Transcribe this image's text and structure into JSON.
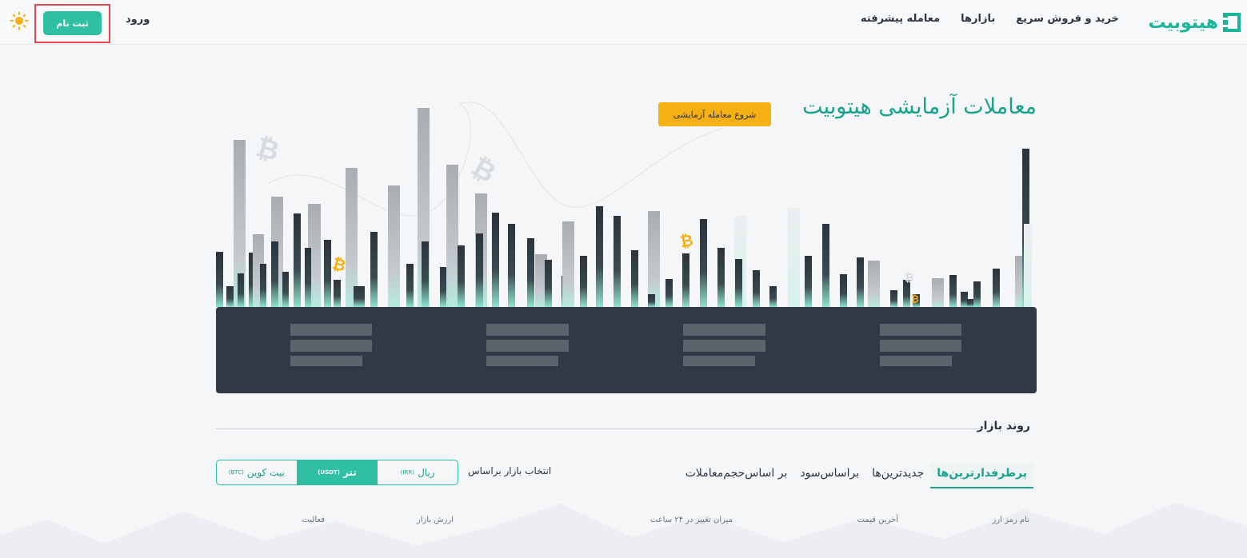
{
  "header": {
    "brand": "هیتوبیت",
    "nav": [
      "خرید و فروش سریع",
      "بازارها",
      "معامله پیشرفته"
    ],
    "login": "ورود",
    "signup": "ثبت نام",
    "theme_icon": "sun-icon"
  },
  "hero": {
    "title": "معاملات آزمایشی هیتوبیت",
    "demo_button": "شروع معامله آزمایشی"
  },
  "trend": {
    "title": "روند بازار",
    "tabs": [
      "پرطرفدارترین‌ها",
      "جدیدترین‌ها",
      "براساس‌سود",
      "بر اساس‌حجم‌معاملات"
    ],
    "active_tab": 0,
    "market_label": "انتخاب بازار براساس",
    "markets": [
      {
        "name": "ریال",
        "code": "(IRR)"
      },
      {
        "name": "تتر",
        "code": "(USDT)"
      },
      {
        "name": "بیت کوین",
        "code": "(BTC)"
      }
    ],
    "active_market": 1,
    "columns": [
      "نام رمز ارز",
      "آخرین قیمت",
      "میزان تغییر در ۲۴ ساعت",
      "ارزش بازار",
      "فعالیت"
    ]
  },
  "colors": {
    "accent": "#2fbfa3",
    "brand_text": "#1ba28a",
    "demo_button": "#f5b014",
    "panel": "#2f3a44"
  }
}
